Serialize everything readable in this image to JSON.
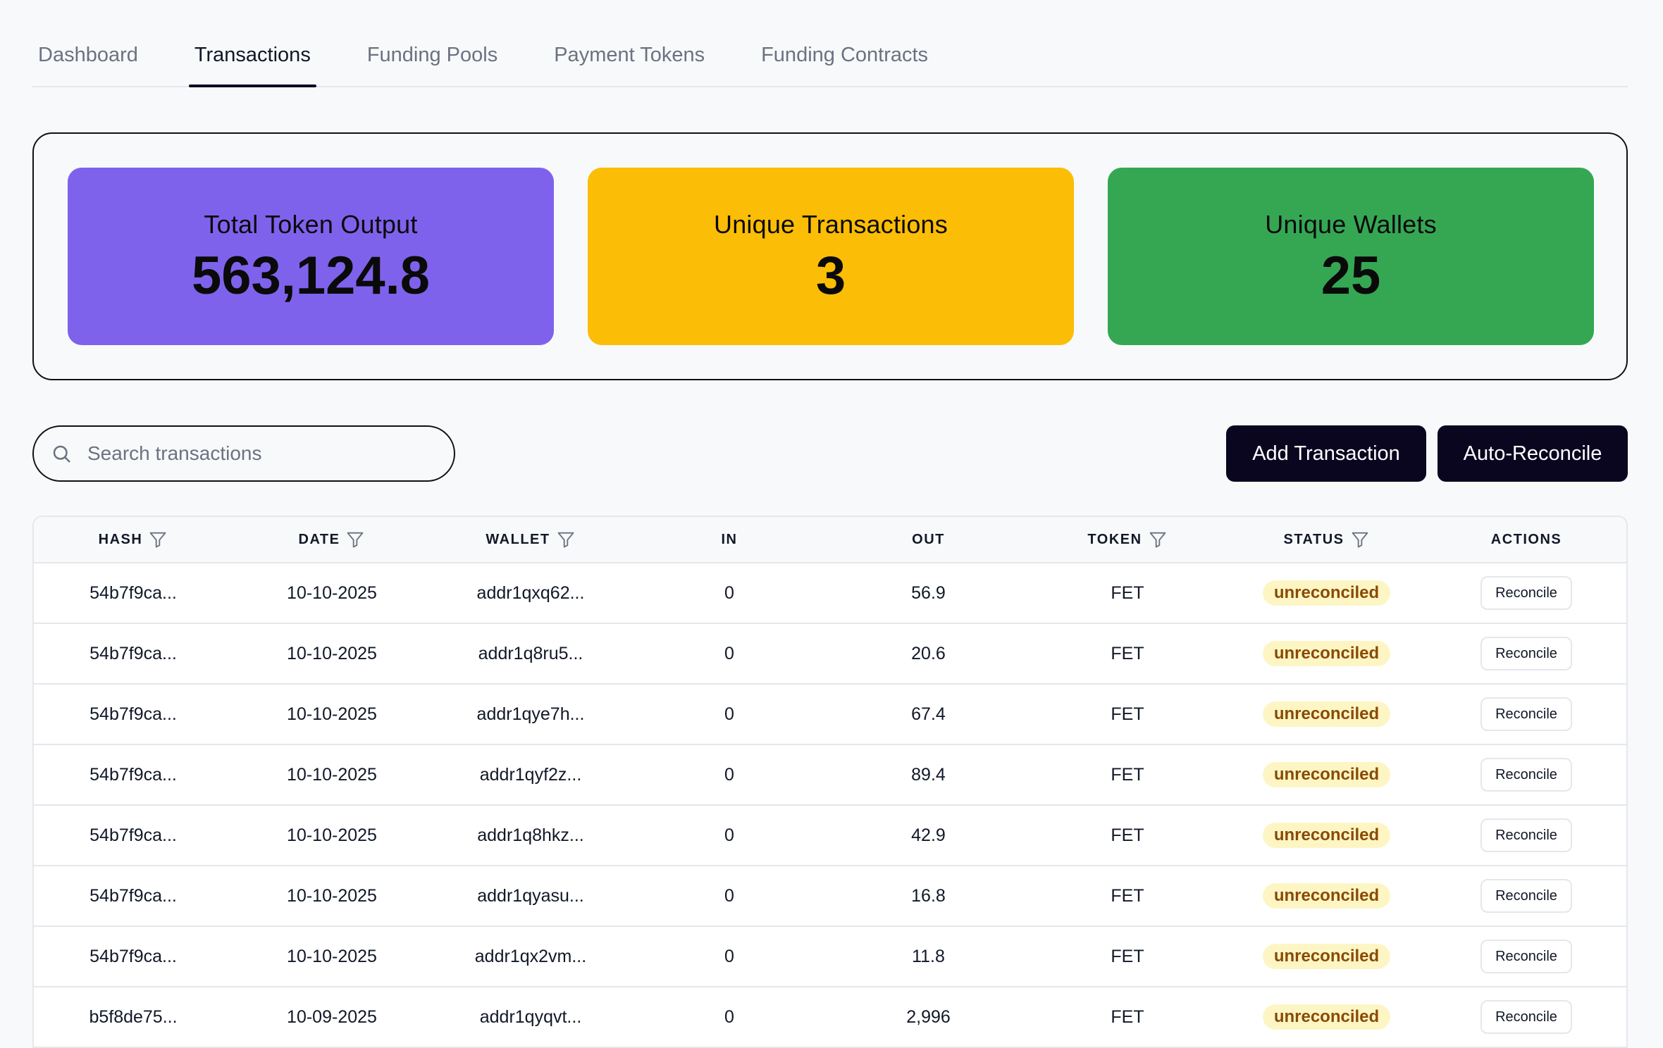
{
  "tabs": [
    {
      "label": "Dashboard",
      "active": false
    },
    {
      "label": "Transactions",
      "active": true
    },
    {
      "label": "Funding Pools",
      "active": false
    },
    {
      "label": "Payment Tokens",
      "active": false
    },
    {
      "label": "Funding Contracts",
      "active": false
    }
  ],
  "stats": [
    {
      "label": "Total Token Output",
      "value": "563,124.8",
      "color": "#7f62ec"
    },
    {
      "label": "Unique Transactions",
      "value": "3",
      "color": "#fbbd06"
    },
    {
      "label": "Unique Wallets",
      "value": "25",
      "color": "#35a753"
    }
  ],
  "search": {
    "placeholder": "Search transactions",
    "value": "",
    "icon": "search-icon"
  },
  "toolbar": {
    "add_label": "Add Transaction",
    "auto_reconcile_label": "Auto-Reconcile"
  },
  "table": {
    "columns": [
      {
        "label": "HASH",
        "filter": true
      },
      {
        "label": "DATE",
        "filter": true
      },
      {
        "label": "WALLET",
        "filter": true
      },
      {
        "label": "IN",
        "filter": false
      },
      {
        "label": "OUT",
        "filter": false
      },
      {
        "label": "TOKEN",
        "filter": true
      },
      {
        "label": "STATUS",
        "filter": true
      },
      {
        "label": "ACTIONS",
        "filter": false
      }
    ],
    "action_label": "Reconcile",
    "rows": [
      {
        "hash": "54b7f9ca...",
        "date": "10-10-2025",
        "wallet": "addr1qxq62...",
        "in": "0",
        "out": "56.9",
        "token": "FET",
        "status": "unreconciled"
      },
      {
        "hash": "54b7f9ca...",
        "date": "10-10-2025",
        "wallet": "addr1q8ru5...",
        "in": "0",
        "out": "20.6",
        "token": "FET",
        "status": "unreconciled"
      },
      {
        "hash": "54b7f9ca...",
        "date": "10-10-2025",
        "wallet": "addr1qye7h...",
        "in": "0",
        "out": "67.4",
        "token": "FET",
        "status": "unreconciled"
      },
      {
        "hash": "54b7f9ca...",
        "date": "10-10-2025",
        "wallet": "addr1qyf2z...",
        "in": "0",
        "out": "89.4",
        "token": "FET",
        "status": "unreconciled"
      },
      {
        "hash": "54b7f9ca...",
        "date": "10-10-2025",
        "wallet": "addr1q8hkz...",
        "in": "0",
        "out": "42.9",
        "token": "FET",
        "status": "unreconciled"
      },
      {
        "hash": "54b7f9ca...",
        "date": "10-10-2025",
        "wallet": "addr1qyasu...",
        "in": "0",
        "out": "16.8",
        "token": "FET",
        "status": "unreconciled"
      },
      {
        "hash": "54b7f9ca...",
        "date": "10-10-2025",
        "wallet": "addr1qx2vm...",
        "in": "0",
        "out": "11.8",
        "token": "FET",
        "status": "unreconciled"
      },
      {
        "hash": "b5f8de75...",
        "date": "10-09-2025",
        "wallet": "addr1qyqvt...",
        "in": "0",
        "out": "2,996",
        "token": "FET",
        "status": "unreconciled"
      }
    ]
  },
  "icons": {
    "filter": "filter-icon",
    "search": "search-icon"
  },
  "colors": {
    "primary_button": "#0b0620",
    "badge_bg": "#fdf6c4",
    "badge_text": "#8a4a05"
  }
}
